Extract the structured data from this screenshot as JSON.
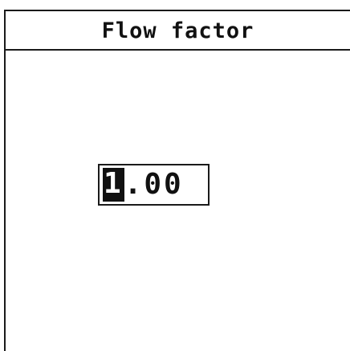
{
  "screen": {
    "title": "Flow factor"
  },
  "flow_factor": {
    "cursor_digit": "1",
    "remaining": ".00"
  }
}
